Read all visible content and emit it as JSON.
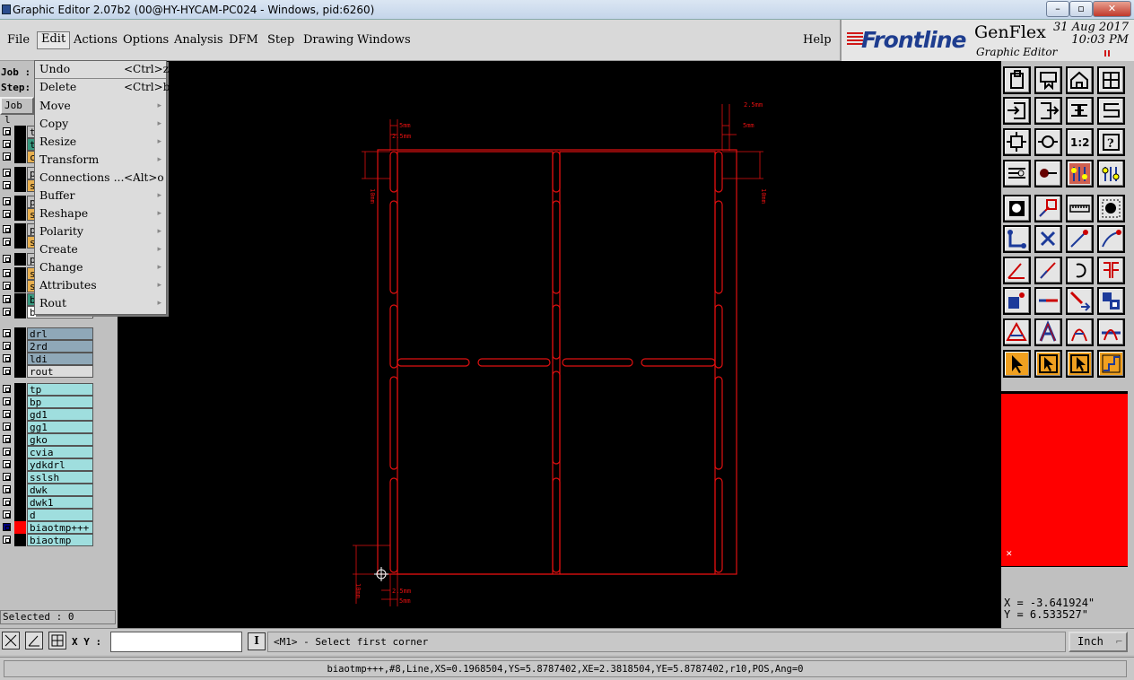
{
  "window": {
    "title": "Graphic Editor 2.07b2 (00@HY-HYCAM-PC024 - Windows, pid:6260)",
    "min": "–",
    "restore": "▫",
    "close": "✕"
  },
  "menubar": {
    "items": [
      "File",
      "Edit",
      "Actions",
      "Options",
      "Analysis",
      "DFM",
      "Step",
      "Drawing",
      "Windows"
    ],
    "help": "Help"
  },
  "brand": {
    "logo": "Frontline",
    "product": "GenFlex",
    "subtitle": "Graphic Editor",
    "date": "31 Aug 2017",
    "time": "10:03 PM",
    "accent": "#d01818",
    "logo_color": "#1e3d8f"
  },
  "edit_menu": {
    "items": [
      {
        "label": "Undo",
        "shortcut": "<Ctrl>z",
        "submenu": false
      },
      {
        "label": "Delete",
        "shortcut": "<Ctrl>b",
        "submenu": false
      },
      {
        "label": "Move",
        "shortcut": "",
        "submenu": true
      },
      {
        "label": "Copy",
        "shortcut": "",
        "submenu": true
      },
      {
        "label": "Resize",
        "shortcut": "",
        "submenu": true
      },
      {
        "label": "Transform",
        "shortcut": "",
        "submenu": true
      },
      {
        "label": "Connections ...",
        "shortcut": "<Alt>o",
        "submenu": false
      },
      {
        "label": "Buffer",
        "shortcut": "",
        "submenu": true
      },
      {
        "label": "Reshape",
        "shortcut": "",
        "submenu": true
      },
      {
        "label": "Polarity",
        "shortcut": "",
        "submenu": true
      },
      {
        "label": "Create",
        "shortcut": "",
        "submenu": true
      },
      {
        "label": "Change",
        "shortcut": "",
        "submenu": true
      },
      {
        "label": "Attributes",
        "shortcut": "",
        "submenu": true
      },
      {
        "label": "Rout",
        "shortcut": "",
        "submenu": true
      }
    ]
  },
  "left_panel": {
    "job_label": "Job :",
    "step_label": "Step:",
    "job_button": "Job l",
    "layers": [
      {
        "name": "t",
        "color": "#c0c0c0",
        "bg": "#c0c0c0"
      },
      {
        "name": "t",
        "color": "#3a9a80",
        "bg": "#3a9a80"
      },
      {
        "name": "c",
        "color": "#e8b050",
        "bg": "#e8b050"
      },
      {
        "name": "p",
        "color": "#ffffff",
        "bg": "#c0c0c0"
      },
      {
        "name": "s",
        "color": "#e8b050",
        "bg": "#e8b050"
      },
      {
        "name": "p",
        "color": "#ffffff",
        "bg": "#c0c0c0"
      },
      {
        "name": "s",
        "color": "#e8b050",
        "bg": "#e8b050"
      },
      {
        "name": "p",
        "color": "#ffffff",
        "bg": "#c0c0c0"
      },
      {
        "name": "s",
        "color": "#e8b050",
        "bg": "#e8b050"
      },
      {
        "name": "p",
        "color": "#ffffff",
        "bg": "#c0c0c0"
      },
      {
        "name": "s",
        "color": "#e8b050",
        "bg": "#e8b050"
      },
      {
        "name": "s",
        "color": "#e8b050",
        "bg": "#e8b050"
      },
      {
        "name": "b",
        "color": "#3a9a80",
        "bg": "#3a9a80"
      },
      {
        "name": "bo",
        "color": "#ffffff",
        "bg": "#ffffff"
      },
      {
        "name": "drl",
        "color": "#8fa8b8",
        "bg": "#8fa8b8"
      },
      {
        "name": "2rd",
        "color": "#8fa8b8",
        "bg": "#8fa8b8"
      },
      {
        "name": "ldi",
        "color": "#8fa8b8",
        "bg": "#8fa8b8"
      },
      {
        "name": "rout",
        "color": "#dcdcdc",
        "bg": "#dcdcdc"
      },
      {
        "name": "tp",
        "color": "#9fdede",
        "bg": "#9fdede"
      },
      {
        "name": "bp",
        "color": "#9fdede",
        "bg": "#9fdede"
      },
      {
        "name": "gd1",
        "color": "#9fdede",
        "bg": "#9fdede"
      },
      {
        "name": "gg1",
        "color": "#9fdede",
        "bg": "#9fdede"
      },
      {
        "name": "gko",
        "color": "#9fdede",
        "bg": "#9fdede"
      },
      {
        "name": "cvia",
        "color": "#9fdede",
        "bg": "#9fdede"
      },
      {
        "name": "ydkdrl",
        "color": "#9fdede",
        "bg": "#9fdede"
      },
      {
        "name": "sslsh",
        "color": "#9fdede",
        "bg": "#9fdede"
      },
      {
        "name": "dwk",
        "color": "#9fdede",
        "bg": "#9fdede"
      },
      {
        "name": "dwk1",
        "color": "#9fdede",
        "bg": "#9fdede"
      },
      {
        "name": "d",
        "color": "#9fdede",
        "bg": "#9fdede"
      },
      {
        "name": "biaotmp+++",
        "color": "#ff0000",
        "bg": "#9fdede"
      },
      {
        "name": "biaotmp",
        "color": "#9fdede",
        "bg": "#9fdede"
      }
    ],
    "selected": "Selected : 0"
  },
  "canvas": {
    "dims": {
      "d5mm_a": "5mm",
      "d25mm_a": "2.5mm",
      "d10mm_a": "10mm",
      "d25mm_b": "2.5mm",
      "d5mm_b": "5mm",
      "d10mm_b": "10mm",
      "d10mm_c": "10mm",
      "d25mm_c": "2.5mm",
      "d5mm_c": "5mm"
    },
    "line_color": "#e01010"
  },
  "toolbar": {
    "tools": [
      "open-icon",
      "save-icon",
      "home-icon",
      "window-icon",
      "import-icon",
      "export-icon",
      "snap-icon",
      "s-curve-icon",
      "fit-icon",
      "zoom-icon",
      "scale-1-2-icon",
      "help-icon",
      "properties-icon",
      "measure-icon",
      "layers-color-icon",
      "layers-icon",
      "pad-icon",
      "shape-icon",
      "ruler-icon",
      "dot-icon",
      "connect-icon",
      "cross-icon",
      "line-point-icon",
      "arc-point-icon",
      "angle-icon",
      "slash-icon",
      "undo-arc-icon",
      "mirror-icon",
      "corner-icon",
      "minus-icon",
      "move-line-icon",
      "blue-blocks-icon",
      "triangle-icon",
      "a-shape-icon",
      "a-curve-icon",
      "a-line-icon",
      "pointer-icon",
      "pointer-box-icon",
      "pointer-rect-icon",
      "route-icon"
    ]
  },
  "coords": {
    "x": "X = -3.641924\"",
    "y": "Y = 6.533527\""
  },
  "bottom": {
    "xy_label": "X Y :",
    "xy_value": "",
    "prompt": "<M1> - Select first corner",
    "unit": "Inch"
  },
  "status": "biaotmp+++,#8,Line,XS=0.1968504,YS=5.8787402,XE=2.3818504,YE=5.8787402,r10,POS,Ang=0"
}
